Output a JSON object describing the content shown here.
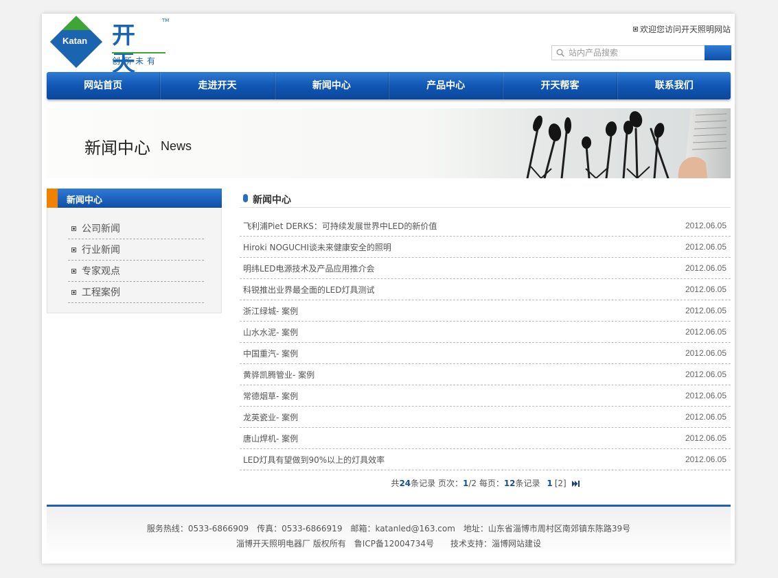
{
  "header": {
    "logo_text": "Katan",
    "logo_cn": "开天",
    "logo_tm": "TM",
    "logo_slogan": "创所未有",
    "welcome": "欢迎您访问开天照明网站",
    "search_placeholder": "站内产品搜索"
  },
  "nav": {
    "items": [
      "网站首页",
      "走进开天",
      "新闻中心",
      "产品中心",
      "开天帮客",
      "联系我们"
    ]
  },
  "banner": {
    "title": "新闻中心",
    "title_en": "News"
  },
  "sidebar": {
    "title": "新闻中心",
    "items": [
      "公司新闻",
      "行业新闻",
      "专家观点",
      "工程案例"
    ]
  },
  "main": {
    "title": "新闻中心",
    "news": [
      {
        "title": "飞利浦Piet DERKS：可持续发展世界中LED的新价值",
        "date": "2012.06.05"
      },
      {
        "title": "Hiroki NOGUCHI谈未来健康安全的照明",
        "date": "2012.06.05"
      },
      {
        "title": "明纬LED电源技术及产品应用推介会",
        "date": "2012.06.05"
      },
      {
        "title": "科锐推出业界最全面的LED灯具测试",
        "date": "2012.06.05"
      },
      {
        "title": "浙江绿城- 案例",
        "date": "2012.06.05"
      },
      {
        "title": "山水水泥- 案例",
        "date": "2012.06.05"
      },
      {
        "title": "中国重汽- 案例",
        "date": "2012.06.05"
      },
      {
        "title": "黄骅凯腾管业- 案例",
        "date": "2012.06.05"
      },
      {
        "title": "常德烟草- 案例",
        "date": "2012.06.05"
      },
      {
        "title": "龙英瓷业- 案例",
        "date": "2012.06.05"
      },
      {
        "title": "唐山焊机- 案例",
        "date": "2012.06.05"
      },
      {
        "title": "LED灯具有望做到90%以上的灯具效率",
        "date": "2012.06.05"
      }
    ]
  },
  "pager": {
    "pre1": "共",
    "total": "24",
    "pre2": "条记录 页次：",
    "page_cur": "1",
    "page_sep": "/2 每页：",
    "per_page": "12",
    "pre3": "条记录",
    "current": "1",
    "page2": "[2]"
  },
  "footer": {
    "line1": "服务热线：0533-6866909　传真：0533-6866919　邮箱：katanled@163.com　地址：山东省淄博市周村区南郊镇东陈路39号",
    "line2": "淄博开天照明电器厂 版权所有　鲁ICP备12004734号　　技术支持：淄博网站建设"
  },
  "colors": {
    "brand_blue": "#1157b3",
    "accent_orange": "#f08200",
    "logo_green": "#3fa535"
  }
}
